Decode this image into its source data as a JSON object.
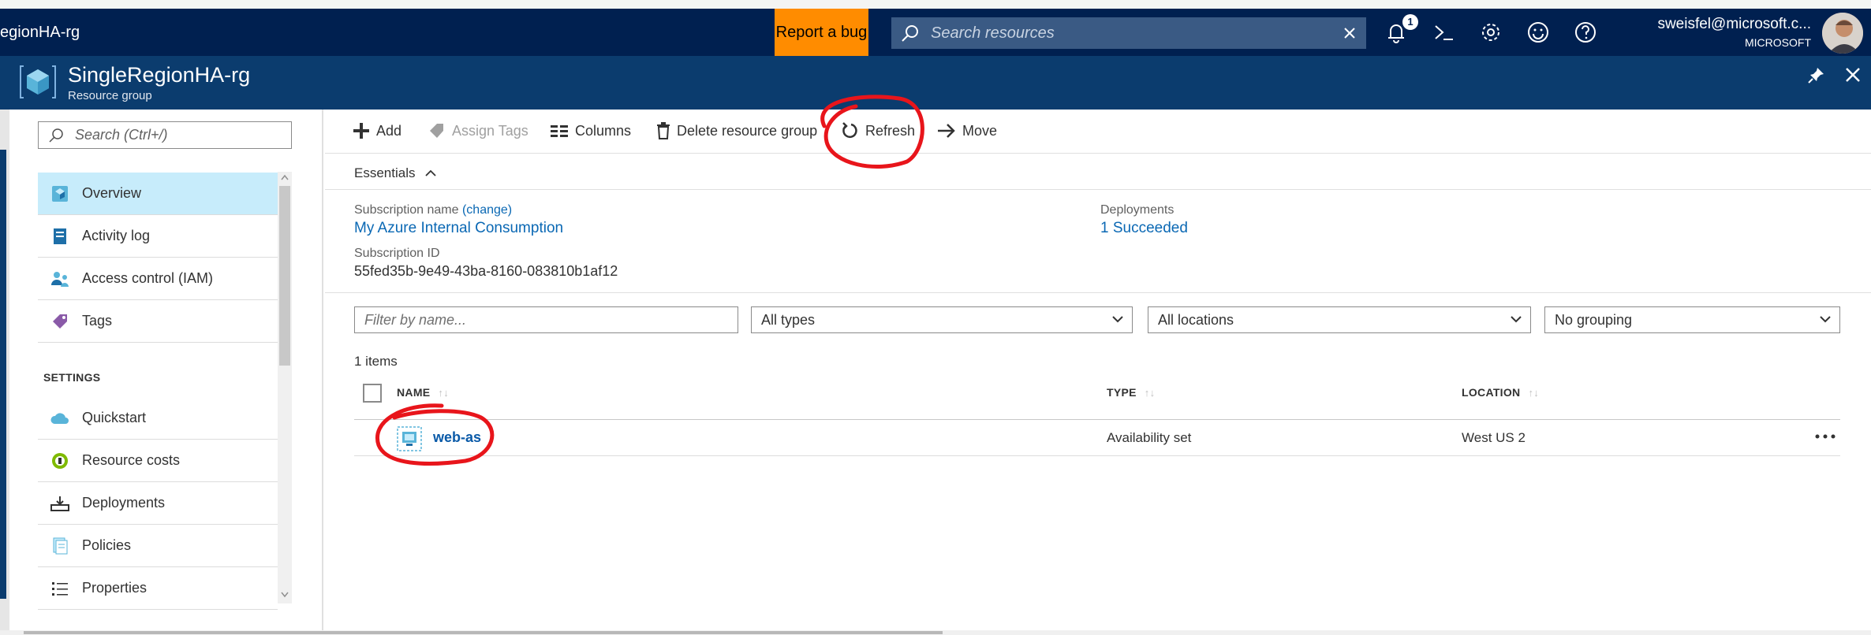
{
  "topbar": {
    "breadcrumb": "egionHA-rg",
    "report_bug": "Report a bug",
    "search_placeholder": "Search resources",
    "notification_count": "1",
    "user_email": "sweisfel@microsoft.c...",
    "user_org": "MICROSOFT"
  },
  "blade": {
    "title": "SingleRegionHA-rg",
    "subtitle": "Resource group"
  },
  "nav": {
    "search_placeholder": "Search (Ctrl+/)",
    "items": [
      {
        "label": "Overview",
        "icon": "overview-icon",
        "active": true
      },
      {
        "label": "Activity log",
        "icon": "activity-log-icon"
      },
      {
        "label": "Access control (IAM)",
        "icon": "iam-icon"
      },
      {
        "label": "Tags",
        "icon": "tag-icon"
      }
    ],
    "settings_header": "SETTINGS",
    "settings_items": [
      {
        "label": "Quickstart",
        "icon": "cloud-icon"
      },
      {
        "label": "Resource costs",
        "icon": "cost-icon"
      },
      {
        "label": "Deployments",
        "icon": "deployments-icon"
      },
      {
        "label": "Policies",
        "icon": "policies-icon"
      },
      {
        "label": "Properties",
        "icon": "properties-icon"
      }
    ]
  },
  "commands": {
    "add": "Add",
    "assign_tags": "Assign Tags",
    "columns": "Columns",
    "delete": "Delete resource group",
    "refresh": "Refresh",
    "move": "Move"
  },
  "essentials": {
    "title": "Essentials",
    "subscription_name_label": "Subscription name",
    "change_link": "(change)",
    "subscription_name": "My Azure Internal Consumption",
    "subscription_id_label": "Subscription ID",
    "subscription_id": "55fed35b-9e49-43ba-8160-083810b1af12",
    "deployments_label": "Deployments",
    "deployments_value": "1 Succeeded"
  },
  "filters": {
    "name_placeholder": "Filter by name...",
    "types": "All types",
    "locations": "All locations",
    "grouping": "No grouping"
  },
  "table": {
    "items_count": "1 items",
    "columns": [
      "NAME",
      "TYPE",
      "LOCATION"
    ],
    "rows": [
      {
        "name": "web-as",
        "type": "Availability set",
        "location": "West US 2"
      }
    ]
  },
  "colors": {
    "topbar": "#002050",
    "blade_header": "#0b3c6e",
    "report_bug": "#ff8c00",
    "link": "#0a68b4",
    "active_nav": "#c7ecfb",
    "annotation": "#e8151b"
  }
}
